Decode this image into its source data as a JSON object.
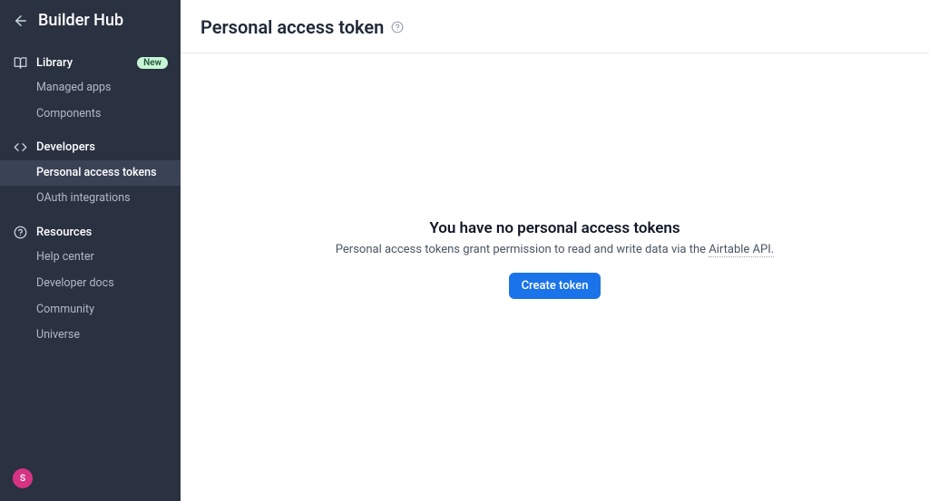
{
  "sidebar": {
    "brand": "Builder Hub",
    "sections": {
      "library": {
        "title": "Library",
        "badge": "New",
        "items": [
          "Managed apps",
          "Components"
        ]
      },
      "developers": {
        "title": "Developers",
        "items": [
          "Personal access tokens",
          "OAuth integrations"
        ]
      },
      "resources": {
        "title": "Resources",
        "items": [
          "Help center",
          "Developer docs",
          "Community",
          "Universe"
        ]
      }
    },
    "avatarInitial": "S"
  },
  "page": {
    "title": "Personal access token"
  },
  "empty": {
    "title": "You have no personal access tokens",
    "descPrefix": "Personal access tokens grant permission to read and write data via the ",
    "apiLinkText": "Airtable API.",
    "createLabel": "Create token"
  }
}
